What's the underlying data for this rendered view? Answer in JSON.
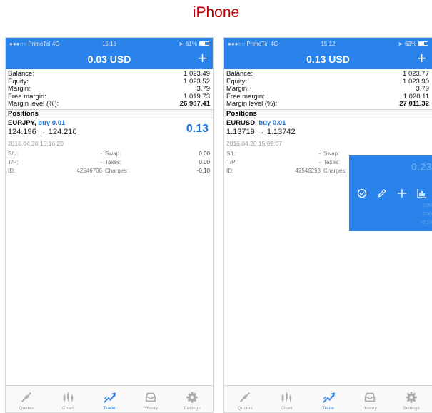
{
  "caption": "iPhone",
  "screens": [
    {
      "status": {
        "carrier": "●●●○○ PrimeTel  4G",
        "time": "15:16",
        "battery": "61%",
        "battery_level": 0.61
      },
      "header": {
        "title": "0.03 USD",
        "add_label": "+"
      },
      "summary": [
        {
          "label": "Balance:",
          "value": "1 023.49"
        },
        {
          "label": "Equity:",
          "value": "1 023.52"
        },
        {
          "label": "Margin:",
          "value": "3.79"
        },
        {
          "label": "Free margin:",
          "value": "1 019.73"
        },
        {
          "label": "Margin level (%):",
          "value": "26 987.41"
        }
      ],
      "section": "Positions",
      "position": {
        "symbol": "EURJPY,",
        "direction": "buy 0.01",
        "prices": "124.196 → 124.210",
        "profit": "0.13",
        "date": "2016.04.20 15:16:20",
        "sl_label": "S/L:",
        "sl_value": "-",
        "swap_label": "Swap:",
        "swap_value": "0.00",
        "tp_label": "T/P:",
        "tp_value": "-",
        "taxes_label": "Taxes:",
        "taxes_value": "0.00",
        "id_label": "ID:",
        "id_value": "42546706",
        "charges_label": "Charges:",
        "charges_value": "-0.10"
      }
    },
    {
      "status": {
        "carrier": "●●●○○ PrimeTel  4G",
        "time": "15:12",
        "battery": "62%",
        "battery_level": 0.62
      },
      "header": {
        "title": "0.13 USD",
        "add_label": "+"
      },
      "summary": [
        {
          "label": "Balance:",
          "value": "1 023.77"
        },
        {
          "label": "Equity:",
          "value": "1 023.90"
        },
        {
          "label": "Margin:",
          "value": "3.79"
        },
        {
          "label": "Free margin:",
          "value": "1 020.11"
        },
        {
          "label": "Margin level (%):",
          "value": "27 011.32"
        }
      ],
      "section": "Positions",
      "position": {
        "symbol": "EURUSD,",
        "direction": "buy 0.01",
        "prices": "1.13719 → 1.13742",
        "profit": "0.23",
        "date": "2016.04.20 15:09:07",
        "sl_label": "S/L:",
        "sl_value": "-",
        "swap_label": "Swap:",
        "swap_value": "0.00",
        "tp_label": "T/P:",
        "tp_value": "-",
        "taxes_label": "Taxes:",
        "taxes_value": "0.00",
        "id_label": "ID:",
        "id_value": "42546293",
        "charges_label": "Charges:",
        "charges_value": "-0.10"
      }
    }
  ],
  "tabs": [
    {
      "label": "Quotes",
      "icon": "quotes-icon"
    },
    {
      "label": "Chart",
      "icon": "chart-icon"
    },
    {
      "label": "Trade",
      "icon": "trade-icon",
      "active": true
    },
    {
      "label": "History",
      "icon": "history-icon"
    },
    {
      "label": "Settings",
      "icon": "settings-icon"
    }
  ],
  "colors": {
    "accent": "#2a83ea",
    "caption": "#c00000",
    "profit": "#1e73d8"
  }
}
